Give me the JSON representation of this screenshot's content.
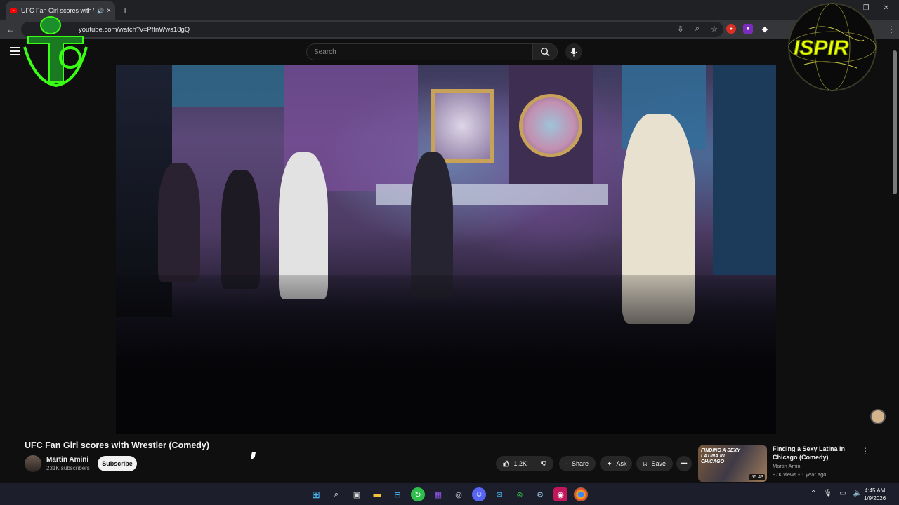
{
  "browser": {
    "tab_title": "UFC Fan Girl scores with W",
    "tab_close": "×",
    "new_tab": "+",
    "url": "youtube.com/watch?v=PfInWws18gQ"
  },
  "youtube": {
    "search_placeholder": "Search"
  },
  "video": {
    "title": "UFC Fan Girl scores with Wrestler (Comedy)",
    "channel_name": "Martin Amini",
    "channel_subs": "231K subscribers",
    "subscribe_label": "Subscribe",
    "like_count": "1.2K",
    "share_label": "Share",
    "ask_label": "Ask",
    "save_label": "Save"
  },
  "related": {
    "thumb_text": "FINDING A SEXY LATINA IN CHICAGO",
    "duration": "55:43",
    "title": "Finding a Sexy Latina in Chicago (Comedy)",
    "channel": "Martin Amini",
    "meta": "97K views • 1 year ago"
  },
  "overlays": {
    "right_logo_text": "ISPIR"
  },
  "taskbar": {
    "time": "4:45 AM",
    "date": "1/9/2026"
  },
  "colors": {
    "youtube_red": "#ff0000",
    "background": "#0f0f0f",
    "logo_green": "#39ff14"
  }
}
